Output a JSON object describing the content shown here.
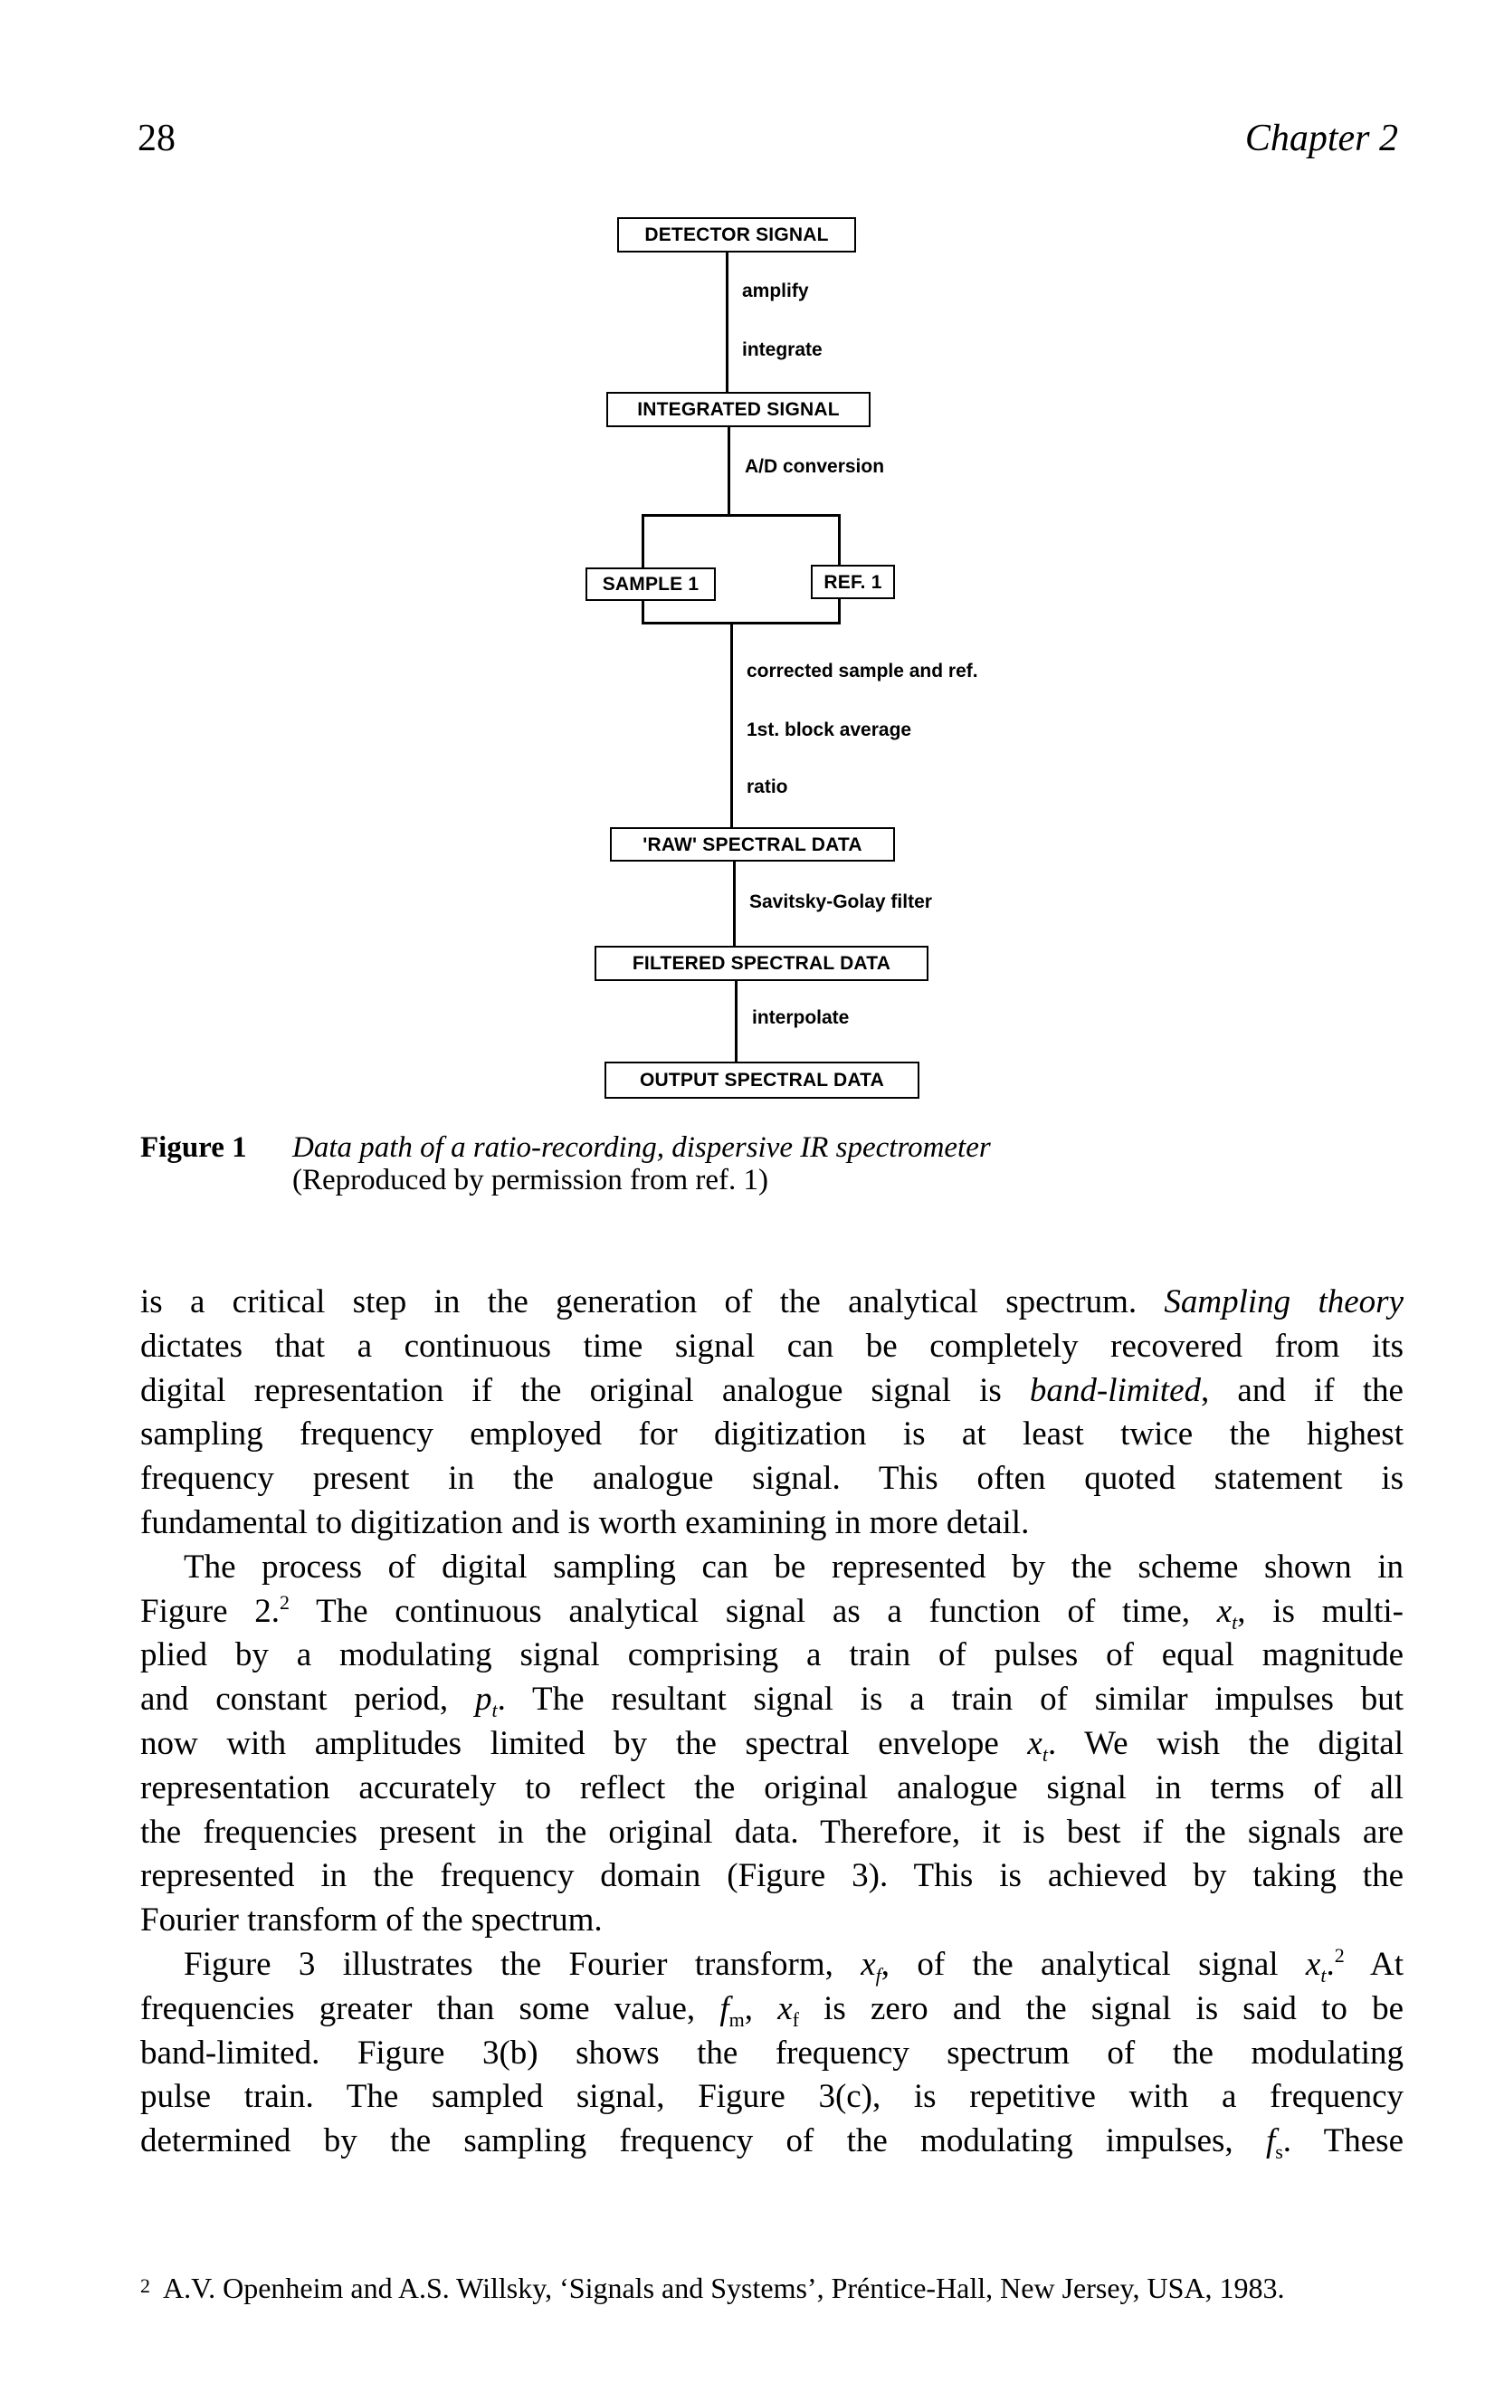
{
  "header": {
    "page_number": "28",
    "running_head": "Chapter 2"
  },
  "flowchart": {
    "boxes": {
      "detector_signal": "DETECTOR SIGNAL",
      "integrated_signal": "INTEGRATED SIGNAL",
      "sample_1": "SAMPLE 1",
      "ref_1": "REF. 1",
      "raw_spectral_data": "'RAW' SPECTRAL DATA",
      "filtered_spectral_data": "FILTERED SPECTRAL DATA",
      "output_spectral_data": "OUTPUT SPECTRAL DATA"
    },
    "steps": {
      "amplify": "amplify",
      "integrate": "integrate",
      "ad_conversion": "A/D conversion",
      "corrected": "corrected sample and ref.",
      "block_average": "1st. block average",
      "ratio": "ratio",
      "savitsky_golay": "Savitsky-Golay filter",
      "interpolate": "interpolate"
    }
  },
  "caption": {
    "label": "Figure 1",
    "title": "Data path of a ratio-recording, dispersive IR spectrometer",
    "credit": "(Reproduced by permission from ref. 1)"
  },
  "body": {
    "p1": [
      [
        "is a critical step in the generation of the analytical spectrum. ",
        "Sampling theory"
      ],
      [
        "dictates that a continuous time signal can be completely recovered from its"
      ],
      [
        "digital representation if the original analogue signal is ",
        "band-limited",
        ", and if the"
      ],
      [
        "sampling frequency employed for digitization is at least twice the highest"
      ],
      [
        "frequency present in the analogue signal. This often quoted statement is"
      ],
      [
        "fundamental to digitization and is worth examining in more detail."
      ]
    ],
    "p2": {
      "l1": "The process of digital sampling can be represented by the scheme shown in",
      "l2a": "Figure 2.",
      "l2_sup": "2",
      "l2b": " The continuous analytical signal as a function of time, ",
      "l2_var": "x",
      "l2_sub": "t",
      "l2c": ", is multi-",
      "l3": "plied by a modulating signal comprising a train of pulses of equal magnitude",
      "l4a": "and constant period, ",
      "l4_var": "p",
      "l4_sub": "t",
      "l4b": ". The resultant signal is a train of similar impulses but",
      "l5a": "now with amplitudes limited by the spectral envelope ",
      "l5_var": "x",
      "l5_sub": "t",
      "l5b": ". We wish the digital",
      "l6": "representation accurately to reflect the original analogue signal in terms of all",
      "l7": "the frequencies present in the original data. Therefore, it is best if the signals are",
      "l8": "represented in the frequency domain (Figure 3). This is achieved by taking the",
      "l9": "Fourier transform of the spectrum."
    },
    "p3": {
      "l1a": "Figure 3 illustrates the Fourier transform, ",
      "l1_var": "x",
      "l1_sub": "f",
      "l1b": ", of the analytical signal ",
      "l1_var2": "x",
      "l1_sub2": "t",
      "l1c": ".",
      "l1_sup": "2",
      "l1d": " At",
      "l2a": "frequencies greater than some value, ",
      "l2_var": "f",
      "l2_sub": "m",
      "l2b": ", ",
      "l2_var2": "x",
      "l2_sub2": "f",
      "l2c": " is zero and the signal is said to be",
      "l3": "band-limited. Figure 3(b) shows the frequency spectrum of the modulating",
      "l4": "pulse train. The sampled signal, Figure 3(c), is repetitive with a frequency",
      "l5a": "determined by the sampling frequency of the modulating impulses, ",
      "l5_var": "f",
      "l5_sub": "s",
      "l5b": ". These"
    }
  },
  "footnote": {
    "mark": "2",
    "text": "A.V. Openheim and A.S. Willsky, ‘Signals and Systems’, Préntice-Hall, New Jersey, USA, 1983."
  }
}
